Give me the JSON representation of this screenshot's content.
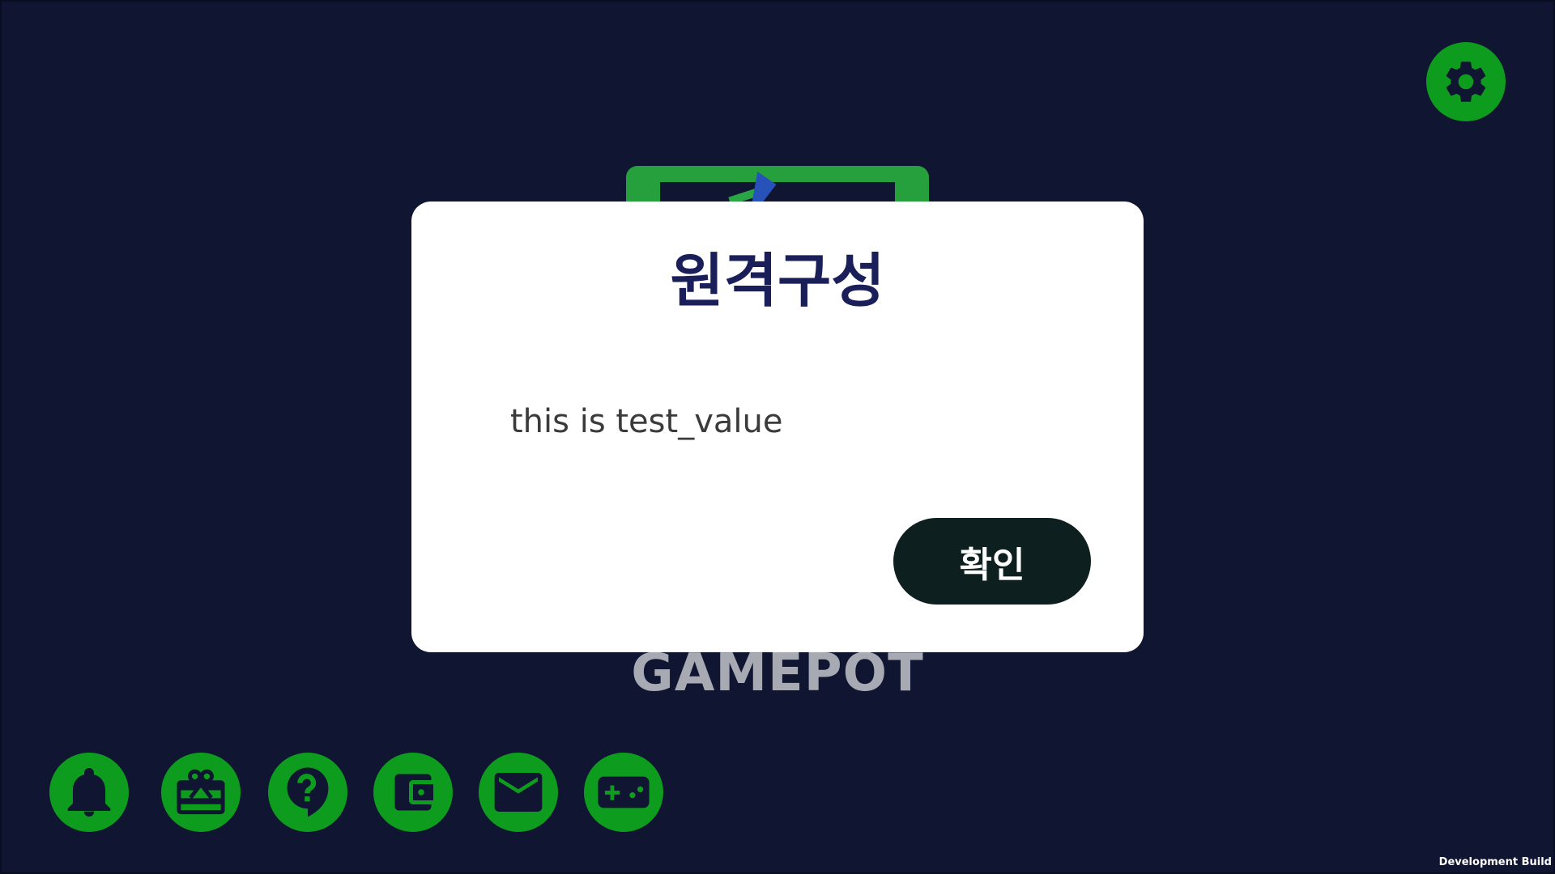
{
  "background_brand": {
    "logo_text": "GAMEPOT"
  },
  "settings": {
    "icon": "gear-icon"
  },
  "bottom_menu": {
    "items": [
      {
        "icon": "bell-icon"
      },
      {
        "icon": "gift-box-icon"
      },
      {
        "icon": "question-bubble-icon"
      },
      {
        "icon": "wallet-icon"
      },
      {
        "icon": "mail-icon"
      },
      {
        "icon": "gamepad-icon"
      }
    ]
  },
  "dialog": {
    "title": "원격구성",
    "message": "this is test_value",
    "confirm_label": "확인"
  },
  "footer": {
    "build_label": "Development Build"
  },
  "colors": {
    "background": "#101631",
    "accent_green": "#0e9c1e",
    "dialog_title": "#1a1f5a",
    "confirm_button": "#0d1f1e"
  }
}
